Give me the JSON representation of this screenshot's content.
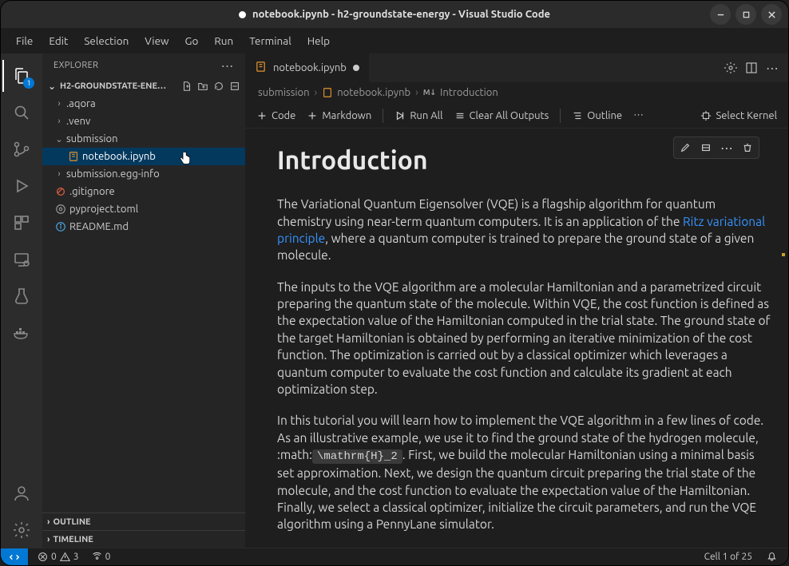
{
  "titlebar": {
    "title": "notebook.ipynb - h2-groundstate-energy - Visual Studio Code"
  },
  "menubar": [
    "File",
    "Edit",
    "Selection",
    "View",
    "Go",
    "Run",
    "Terminal",
    "Help"
  ],
  "activitybar": {
    "explorer_badge": "1"
  },
  "sidebar": {
    "title": "EXPLORER",
    "project": "H2-GROUNDSTATE-ENE…",
    "tree": [
      {
        "name": ".aqora",
        "type": "folder",
        "depth": 1,
        "expanded": false
      },
      {
        "name": ".venv",
        "type": "folder",
        "depth": 1,
        "expanded": false
      },
      {
        "name": "submission",
        "type": "folder",
        "depth": 1,
        "expanded": true
      },
      {
        "name": "notebook.ipynb",
        "type": "notebook",
        "depth": 2,
        "selected": true
      },
      {
        "name": "submission.egg-info",
        "type": "folder",
        "depth": 1,
        "expanded": false
      },
      {
        "name": ".gitignore",
        "type": "file",
        "depth": 1
      },
      {
        "name": "pyproject.toml",
        "type": "file",
        "depth": 1
      },
      {
        "name": "README.md",
        "type": "infofile",
        "depth": 1
      }
    ],
    "outline": "OUTLINE",
    "timeline": "TIMELINE"
  },
  "tabs": {
    "active": {
      "label": "notebook.ipynb",
      "dirty": true
    }
  },
  "breadcrumbs": {
    "items": [
      "submission",
      "notebook.ipynb",
      "Introduction"
    ]
  },
  "toolbar": {
    "code": "Code",
    "markdown": "Markdown",
    "runall": "Run All",
    "clear": "Clear All Outputs",
    "outline": "Outline",
    "kernel": "Select Kernel"
  },
  "cell": {
    "heading": "Introduction",
    "p1a": "The Variational Quantum Eigensolver (VQE) is a flagship algorithm for quantum chemistry using near-term quantum computers. It is an application of the ",
    "p1link": "Ritz variational principle",
    "p1b": ", where a quantum computer is trained to prepare the ground state of a given molecule.",
    "p2": "The inputs to the VQE algorithm are a molecular Hamiltonian and a parametrized circuit preparing the quantum state of the molecule. Within VQE, the cost function is defined as the expectation value of the Hamiltonian computed in the trial state. The ground state of the target Hamiltonian is obtained by performing an iterative minimization of the cost function. The optimization is carried out by a classical optimizer which leverages a quantum computer to evaluate the cost function and calculate its gradient at each optimization step.",
    "p3a": "In this tutorial you will learn how to implement the VQE algorithm in a few lines of code. As an illustrative example, we use it to find the ground state of the hydrogen molecule, :math:",
    "p3code": "\\mathrm{H}_2",
    "p3b": ". First, we build the molecular Hamiltonian using a minimal basis set approximation. Next, we design the quantum circuit preparing the trial state of the molecule, and the cost function to evaluate the expectation value of the Hamiltonian. Finally, we select a classical optimizer, initialize the circuit parameters, and run the VQE algorithm using a PennyLane simulator."
  },
  "statusbar": {
    "errors": "0",
    "warnings": "3",
    "ports": "0",
    "cell_pos": "Cell 1 of 25"
  }
}
